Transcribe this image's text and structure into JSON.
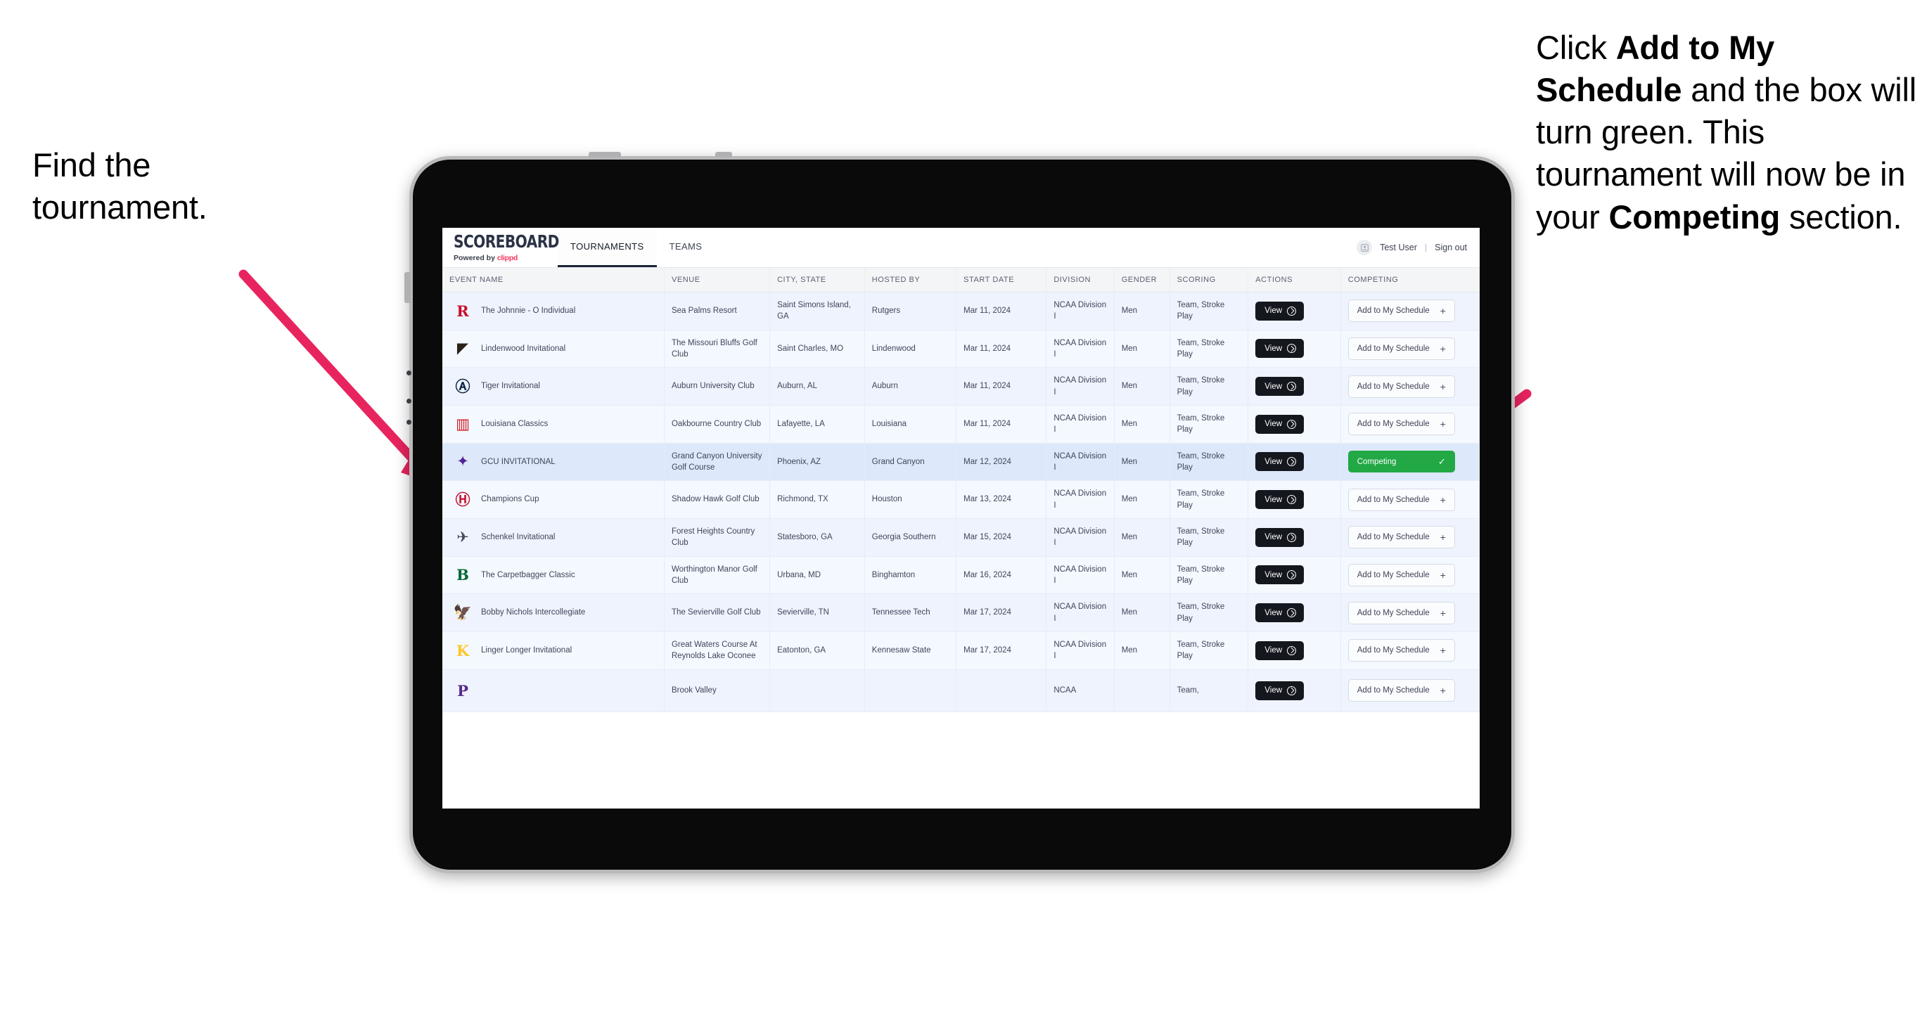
{
  "annotations": {
    "left": {
      "line1": "Find the",
      "line2": "tournament."
    },
    "right": {
      "seg1": "Click ",
      "bold1": "Add to My Schedule",
      "seg2": " and the box will turn green. This tournament will now be in your ",
      "bold2": "Competing",
      "seg3": " section."
    },
    "arrow_color": "#E8245E"
  },
  "app": {
    "brand": {
      "title": "SCOREBOARD",
      "powered_prefix": "Powered by ",
      "powered_name": "clippd"
    },
    "tabs": [
      {
        "label": "TOURNAMENTS",
        "active": true
      },
      {
        "label": "TEAMS",
        "active": false
      }
    ],
    "header_right": {
      "avatar_icon": "user-avatar-icon",
      "user_name": "Test User",
      "separator": "|",
      "sign_out": "Sign out"
    },
    "table": {
      "columns": [
        "EVENT NAME",
        "VENUE",
        "CITY, STATE",
        "HOSTED BY",
        "START DATE",
        "DIVISION",
        "GENDER",
        "SCORING",
        "ACTIONS",
        "COMPETING"
      ],
      "buttons": {
        "view": "View",
        "add": "Add to My Schedule",
        "add_plus": "+",
        "competing": "Competing",
        "competing_check": "✓"
      },
      "rows": [
        {
          "logo": "R",
          "logo_color": "#c8102e",
          "logo_font": "serif",
          "event": "The Johnnie - O Individual",
          "venue": "Sea Palms Resort",
          "city": "Saint Simons Island, GA",
          "host": "Rutgers",
          "date": "Mar 11, 2024",
          "division": "NCAA Division I",
          "gender": "Men",
          "scoring": "Team, Stroke Play",
          "competing": false
        },
        {
          "logo": "◤",
          "logo_color": "#2a2118",
          "logo_font": "sans",
          "event": "Lindenwood Invitational",
          "venue": "The Missouri Bluffs Golf Club",
          "city": "Saint Charles, MO",
          "host": "Lindenwood",
          "date": "Mar 11, 2024",
          "division": "NCAA Division I",
          "gender": "Men",
          "scoring": "Team, Stroke Play",
          "competing": false
        },
        {
          "logo": "Ⓐ",
          "logo_color": "#0c2340",
          "logo_font": "serif",
          "event": "Tiger Invitational",
          "venue": "Auburn University Club",
          "city": "Auburn, AL",
          "host": "Auburn",
          "date": "Mar 11, 2024",
          "division": "NCAA Division I",
          "gender": "Men",
          "scoring": "Team, Stroke Play",
          "competing": false
        },
        {
          "logo": "▥",
          "logo_color": "#ce181e",
          "logo_font": "sans",
          "event": "Louisiana Classics",
          "venue": "Oakbourne Country Club",
          "city": "Lafayette, LA",
          "host": "Louisiana",
          "date": "Mar 11, 2024",
          "division": "NCAA Division I",
          "gender": "Men",
          "scoring": "Team, Stroke Play",
          "competing": false
        },
        {
          "logo": "✦",
          "logo_color": "#522398",
          "logo_font": "sans",
          "event": "GCU INVITATIONAL",
          "venue": "Grand Canyon University Golf Course",
          "city": "Phoenix, AZ",
          "host": "Grand Canyon",
          "date": "Mar 12, 2024",
          "division": "NCAA Division I",
          "gender": "Men",
          "scoring": "Team, Stroke Play",
          "competing": true,
          "selected": true
        },
        {
          "logo": "Ⓗ",
          "logo_color": "#c8102e",
          "logo_font": "serif",
          "event": "Champions Cup",
          "venue": "Shadow Hawk Golf Club",
          "city": "Richmond, TX",
          "host": "Houston",
          "date": "Mar 13, 2024",
          "division": "NCAA Division I",
          "gender": "Men",
          "scoring": "Team, Stroke Play",
          "competing": false
        },
        {
          "logo": "✈",
          "logo_color": "#27needs",
          "logo_font": "sans",
          "event": "Schenkel Invitational",
          "venue": "Forest Heights Country Club",
          "city": "Statesboro, GA",
          "host": "Georgia Southern",
          "date": "Mar 15, 2024",
          "division": "NCAA Division I",
          "gender": "Men",
          "scoring": "Team, Stroke Play",
          "competing": false
        },
        {
          "logo": "B",
          "logo_color": "#046a38",
          "logo_font": "serif",
          "event": "The Carpetbagger Classic",
          "venue": "Worthington Manor Golf Club",
          "city": "Urbana, MD",
          "host": "Binghamton",
          "date": "Mar 16, 2024",
          "division": "NCAA Division I",
          "gender": "Men",
          "scoring": "Team, Stroke Play",
          "competing": false
        },
        {
          "logo": "🦅",
          "logo_color": "#4e2a84",
          "logo_font": "sans",
          "event": "Bobby Nichols Intercollegiate",
          "venue": "The Sevierville Golf Club",
          "city": "Sevierville, TN",
          "host": "Tennessee Tech",
          "date": "Mar 17, 2024",
          "division": "NCAA Division I",
          "gender": "Men",
          "scoring": "Team, Stroke Play",
          "competing": false
        },
        {
          "logo": "K",
          "logo_color": "#ffc629",
          "logo_font": "serif",
          "event": "Linger Longer Invitational",
          "venue": "Great Waters Course At Reynolds Lake Oconee",
          "city": "Eatonton, GA",
          "host": "Kennesaw State",
          "date": "Mar 17, 2024",
          "division": "NCAA Division I",
          "gender": "Men",
          "scoring": "Team, Stroke Play",
          "competing": false
        },
        {
          "logo": "P",
          "logo_color": "#592a8a",
          "logo_font": "serif",
          "event": "",
          "venue": "Brook Valley",
          "city": "",
          "host": "",
          "date": "",
          "division": "NCAA",
          "gender": "",
          "scoring": "Team,",
          "competing": false,
          "clipped": true
        }
      ]
    }
  }
}
